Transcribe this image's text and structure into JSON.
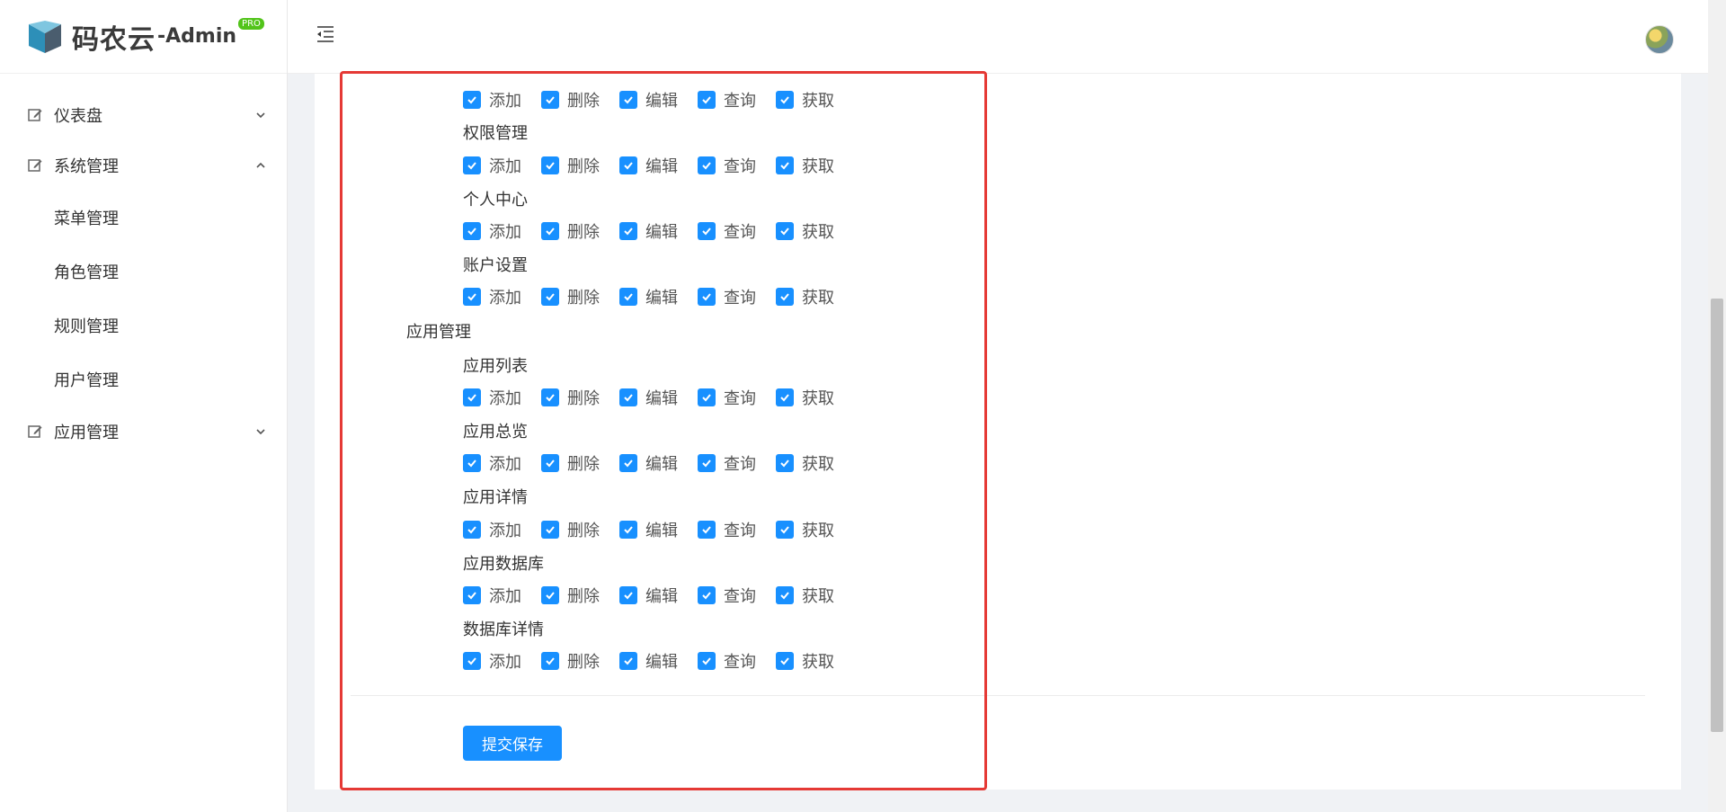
{
  "brand": {
    "name": "码农云",
    "suffix": "-Admin",
    "badge": "PRO"
  },
  "sidebar": {
    "items": [
      {
        "label": "仪表盘",
        "expanded": false
      },
      {
        "label": "系统管理",
        "expanded": true,
        "children": [
          "菜单管理",
          "角色管理",
          "规则管理",
          "用户管理"
        ]
      },
      {
        "label": "应用管理",
        "expanded": false
      }
    ]
  },
  "permissions": {
    "actions": [
      "添加",
      "删除",
      "编辑",
      "查询",
      "获取"
    ],
    "groups": [
      {
        "title": "",
        "subs": [
          {
            "title": ""
          },
          {
            "title": "权限管理"
          },
          {
            "title": "个人中心"
          },
          {
            "title": "账户设置"
          }
        ]
      },
      {
        "title": "应用管理",
        "subs": [
          {
            "title": "应用列表"
          },
          {
            "title": "应用总览"
          },
          {
            "title": "应用详情"
          },
          {
            "title": "应用数据库"
          },
          {
            "title": "数据库详情"
          }
        ]
      }
    ]
  },
  "actions": {
    "submit_label": "提交保存"
  },
  "colors": {
    "primary": "#1890ff",
    "highlight": "#e53935",
    "badge": "#52c41a"
  }
}
